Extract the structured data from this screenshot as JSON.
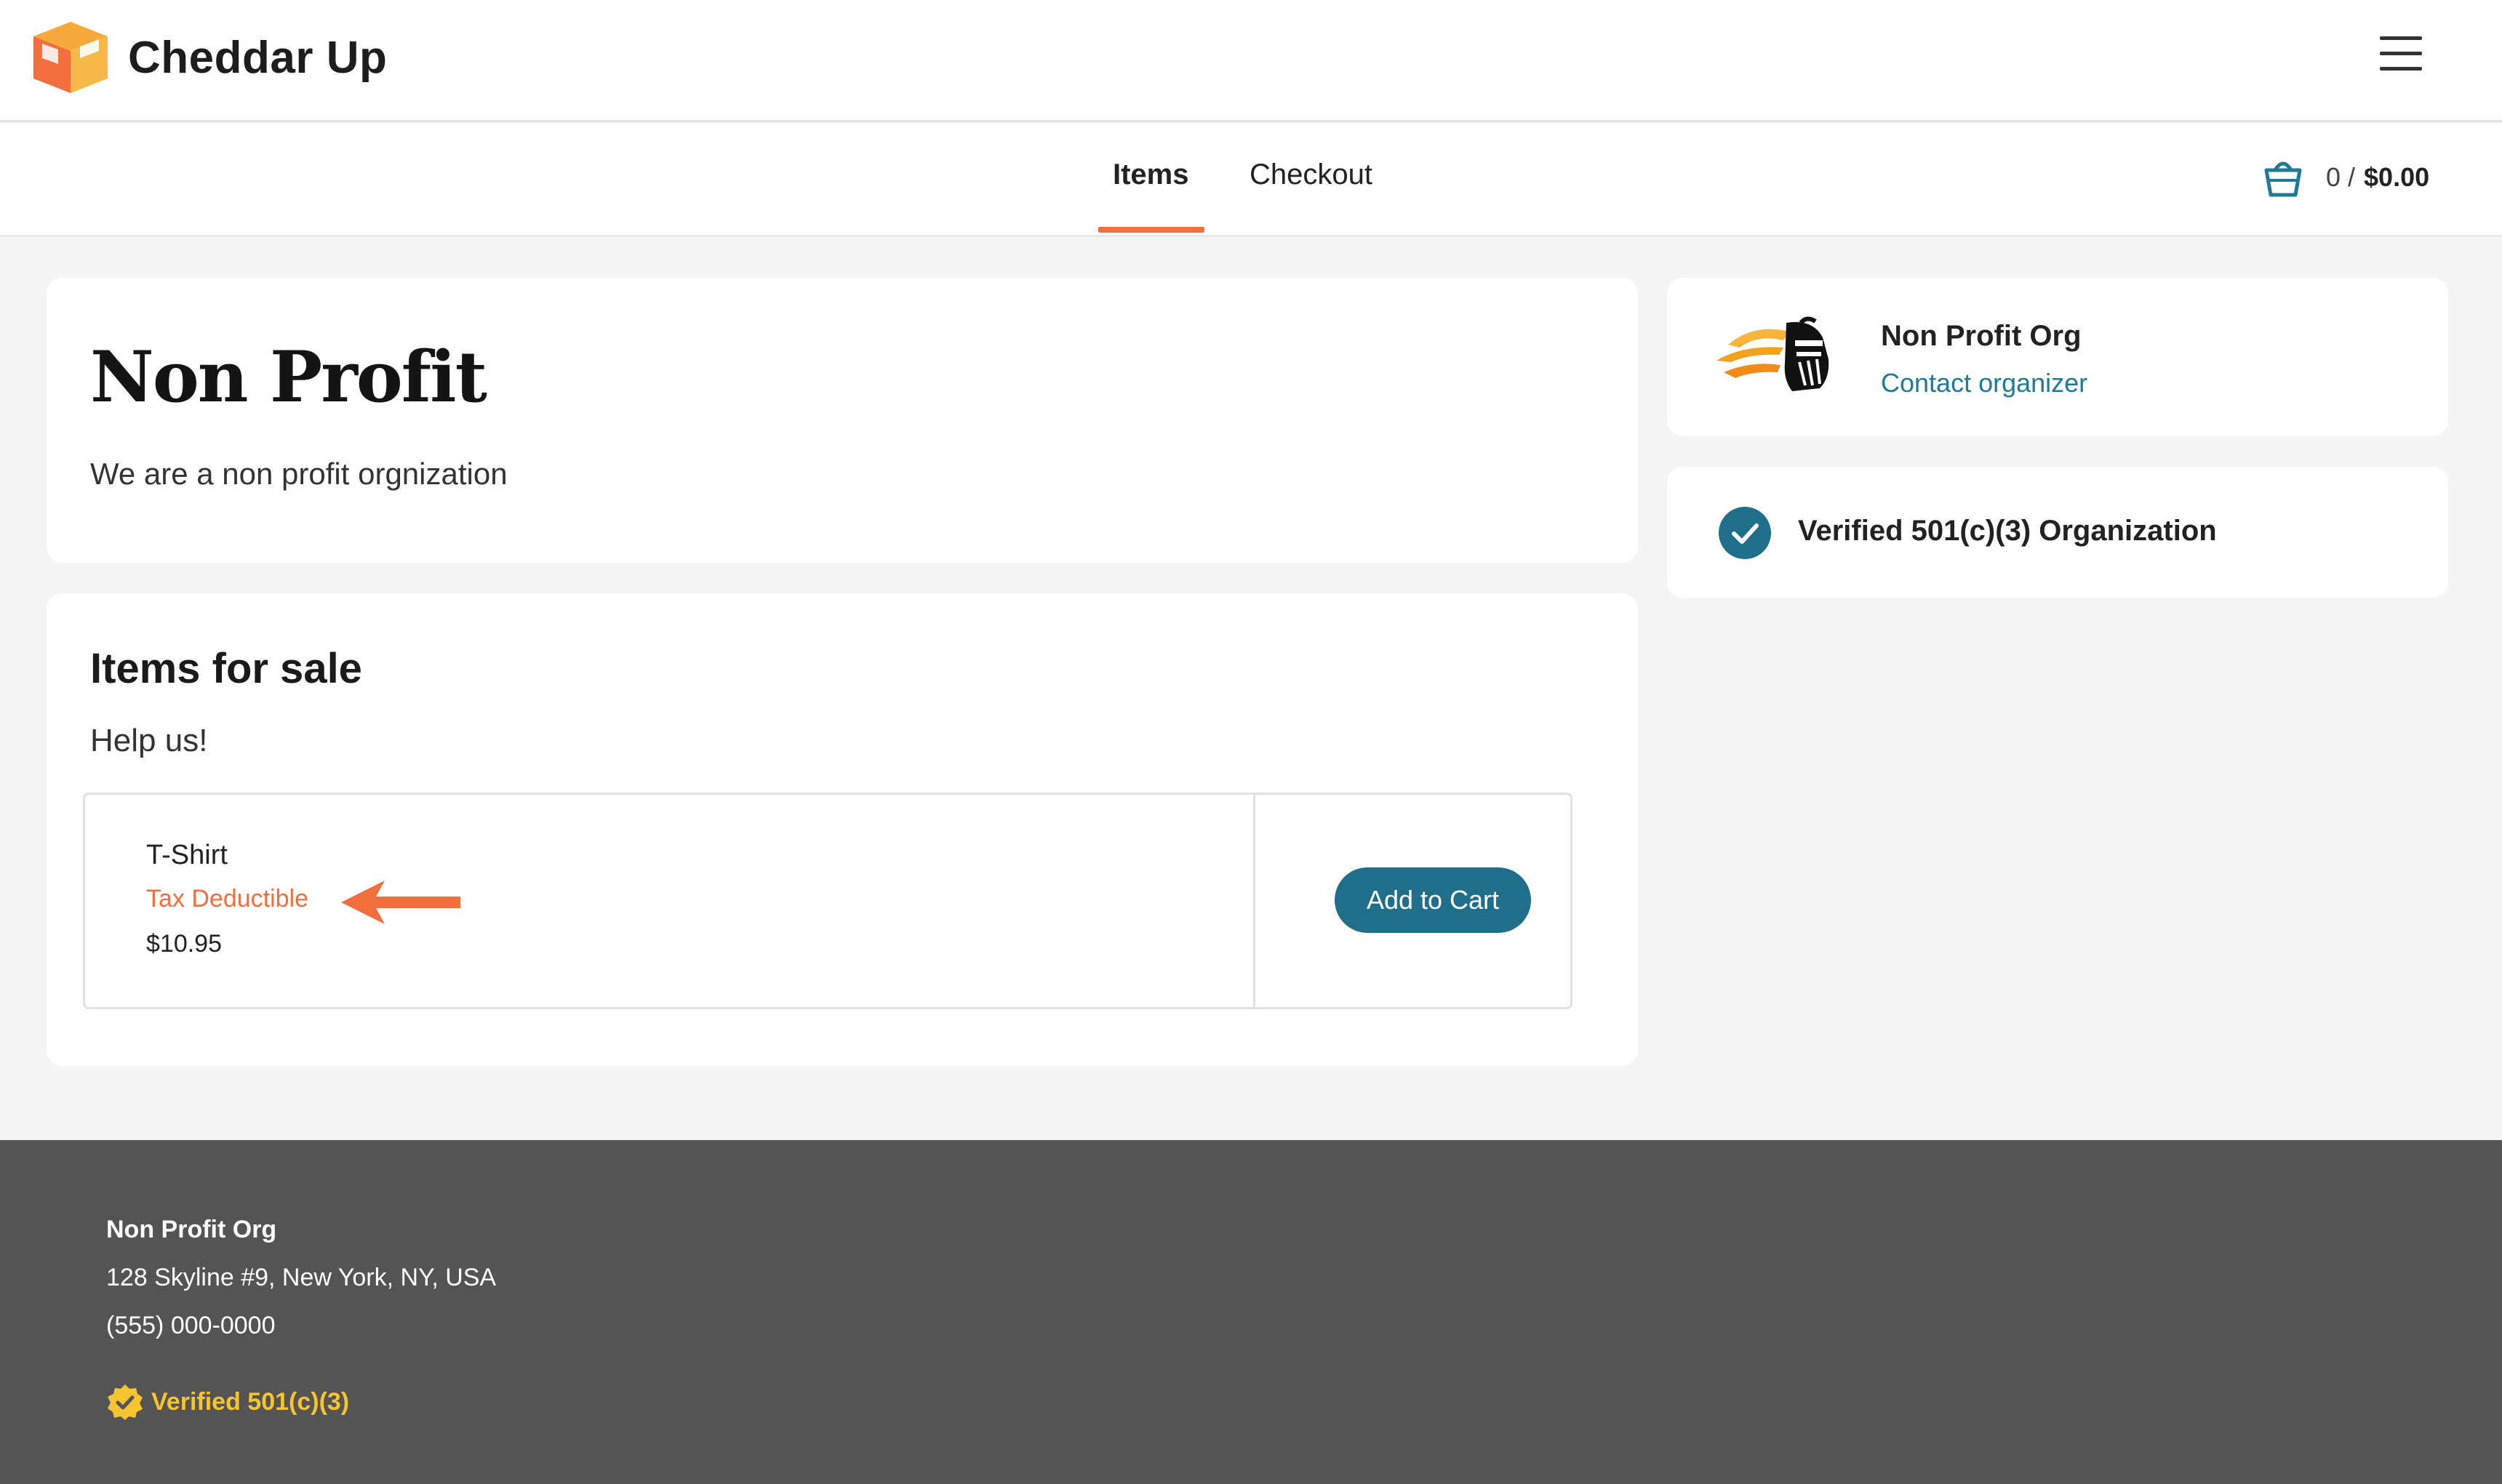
{
  "header": {
    "brand": "Cheddar Up",
    "logo_icon": "cheddar-box-logo",
    "menu_icon": "hamburger-menu-icon"
  },
  "nav": {
    "tabs": [
      {
        "label": "Items",
        "active": true
      },
      {
        "label": "Checkout",
        "active": false
      }
    ],
    "cart": {
      "icon": "basket-icon",
      "count": "0 /",
      "total": "$0.00"
    }
  },
  "page": {
    "title": "Non Profit",
    "description": "We are a non profit orgnization"
  },
  "items_section": {
    "title": "Items for sale",
    "subtitle": "Help us!",
    "items": [
      {
        "name": "T-Shirt",
        "tag": "Tax Deductible",
        "price": "$10.95",
        "button_label": "Add to Cart"
      }
    ]
  },
  "organizer": {
    "name": "Non Profit Org",
    "contact_label": "Contact organizer",
    "logo_icon": "knight-helmet-logo"
  },
  "verification": {
    "label": "Verified 501(c)(3) Organization",
    "icon": "check-circle-icon"
  },
  "footer": {
    "org_name": "Non Profit Org",
    "address": "128 Skyline #9, New York, NY, USA",
    "phone": "(555) 000-0000",
    "badge_label": "Verified 501(c)(3)",
    "badge_icon": "verified-badge-icon"
  },
  "colors": {
    "accent": "#f26e3c",
    "primary_button": "#1f6f8b",
    "link": "#1f7a96",
    "footer_bg": "#545454",
    "badge": "#f5c431"
  }
}
